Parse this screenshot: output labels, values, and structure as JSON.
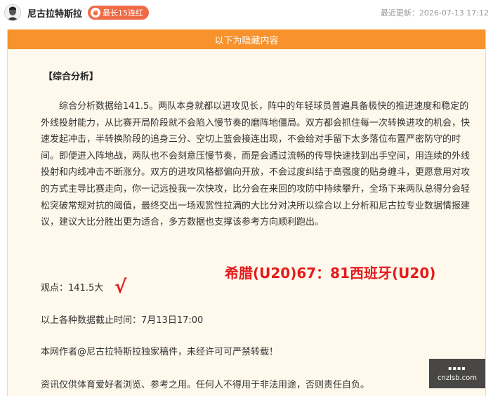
{
  "header": {
    "author_name": "尼古拉特斯拉",
    "streak_badge": "最长15连红",
    "updated_text": "最近更新：2026-07-13 17:12"
  },
  "content": {
    "hidden_bar": "以下为隐藏内容",
    "section_title": "【综合分析】",
    "analysis_text": "综合分析数据给141.5。两队本身就都以进攻见长，阵中的年轻球员普遍具备极快的推进速度和稳定的外线投射能力，从比赛开局阶段就不会陷入慢节奏的磨阵地僵局。双方都会抓住每一次转换进攻的机会，快速发起冲击，半转换阶段的追身三分、空切上篮会接连出现，不会给对手留下太多落位布置严密防守的时间。即便进入阵地战，两队也不会刻意压慢节奏，而是会通过流畅的传导快速找到出手空间，用连续的外线投射和内线冲击不断涨分。双方的进攻风格都偏向开放，不会过度纠结于高强度的贴身缠斗，更愿意用对攻的方式主导比赛走向，你一记远投我一次快攻，比分会在来回的攻防中持续攀升，全场下来两队总得分会轻松突破常规对抗的阈值，最终交出一场观赏性拉满的大比分对决所以综合以上分析和尼古拉专业数据情报建议，建议大比分胜出更为适合，多方数据也支撑该参考方向顺利跑出。",
    "opinion": "观点：141.5大",
    "check_mark": "√",
    "match_title": "希腊(U20)67：81西班牙(U20)",
    "cutoff": "以上各种数据截止时间：7月13日17:00",
    "copyright": "本网作者@尼古拉特斯拉独家稿件，未经许可可严禁转载！",
    "disclaimer": "资讯仅供体育爱好者浏览、参考之用。任何人不得用于非法用途，否则责任自负。"
  },
  "watermark": {
    "top": "▪▪▪▪",
    "site": "cnzlsb.com"
  },
  "colors": {
    "accent_orange": "#f7922d",
    "badge_red": "#f06a45",
    "highlight_red": "#e41b1b",
    "content_bg": "#fff8ec"
  },
  "icons": {
    "avatar": "avatar-portrait",
    "badge": "flame-icon"
  }
}
